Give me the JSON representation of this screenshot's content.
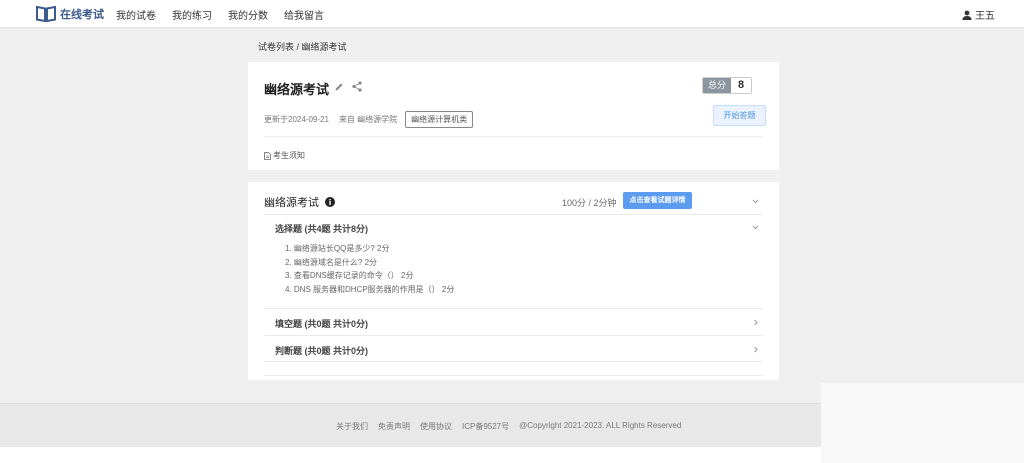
{
  "topnav": {
    "brand": "在线考试",
    "items": [
      "我的试卷",
      "我的练习",
      "我的分数",
      "给我留言"
    ],
    "user": "王五"
  },
  "breadcrumb": "试卷列表 / 幽络源考试",
  "exam": {
    "title": "幽络源考试",
    "score_label": "总分",
    "score_value": "8",
    "updated": "更新于2024-09-21",
    "from": "来自 幽络源学院",
    "tag": "幽络源计算机类",
    "start_button": "开始答题",
    "notice": "考生须知"
  },
  "section": {
    "title": "幽络源考试",
    "meta": "100分 / 2分钟",
    "detail_button": "点击查看试题详情",
    "groups": [
      {
        "title": "选择题 (共4题 共计8分)",
        "expanded": true,
        "questions": [
          "1. 幽络源站长QQ是多少?  2分",
          "2. 幽络源域名是什么?  2分",
          "3. 查看DNS缓存记录的命令（）  2分",
          "4. DNS 服务器和DHCP服务器的作用是（）  2分"
        ]
      },
      {
        "title": "填空题 (共0题 共计0分)",
        "expanded": false
      },
      {
        "title": "判断题 (共0题 共计0分)",
        "expanded": false
      }
    ]
  },
  "footer": {
    "links": [
      "关于我们",
      "免责声明",
      "使用协议",
      "ICP备9527号",
      "@Copyright 2021-2023. ALL Rights Reserved"
    ]
  },
  "colors": {
    "brand": "#3d5b8f",
    "primary": "#5b9bf0",
    "score_label_bg": "#8c96a0"
  }
}
